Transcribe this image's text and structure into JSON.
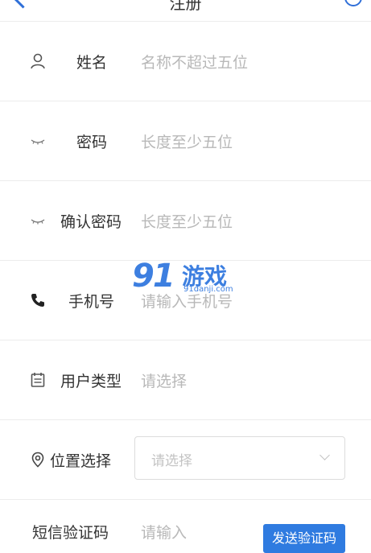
{
  "header": {
    "title": "注册"
  },
  "form": {
    "name": {
      "label": "姓名",
      "placeholder": "名称不超过五位"
    },
    "password": {
      "label": "密码",
      "placeholder": "长度至少五位"
    },
    "confirm_password": {
      "label": "确认密码",
      "placeholder": "长度至少五位"
    },
    "phone": {
      "label": "手机号",
      "placeholder": "请输入手机号"
    },
    "user_type": {
      "label": "用户类型",
      "placeholder": "请选择"
    },
    "location": {
      "label": "位置选择",
      "placeholder": "请选择"
    },
    "sms_code": {
      "label": "短信验证码",
      "placeholder": "请输入",
      "button": "发送验证码"
    }
  },
  "watermark": {
    "logo": "91",
    "text": "游戏",
    "url": "91danji.com"
  },
  "icons": {
    "name": "user-icon",
    "password": "eye-closed-icon",
    "confirm_password": "eye-closed-icon",
    "phone": "phone-icon",
    "user_type": "calendar-icon",
    "location": "location-pin-icon"
  },
  "colors": {
    "accent": "#2f7be0",
    "placeholder": "#b8b8b8",
    "divider": "#ececec"
  }
}
